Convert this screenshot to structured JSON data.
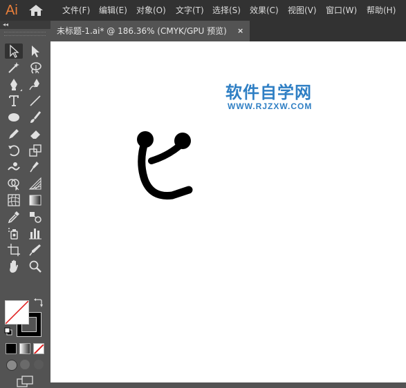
{
  "app": {
    "logo_text": "Ai",
    "home_icon": "home-icon"
  },
  "menu": [
    {
      "label": "文件(F)"
    },
    {
      "label": "编辑(E)"
    },
    {
      "label": "对象(O)"
    },
    {
      "label": "文字(T)"
    },
    {
      "label": "选择(S)"
    },
    {
      "label": "效果(C)"
    },
    {
      "label": "视图(V)"
    },
    {
      "label": "窗口(W)"
    },
    {
      "label": "帮助(H)"
    }
  ],
  "document_tab": {
    "label": "未标题-1.ai* @ 186.36% (CMYK/GPU 预览)",
    "close_label": "×"
  },
  "toolbar": {
    "collapse_label": "◂◂",
    "tools": [
      {
        "name": "selection-tool-icon",
        "active": true
      },
      {
        "name": "direct-selection-tool-icon"
      },
      {
        "name": "magic-wand-tool-icon"
      },
      {
        "name": "lasso-tool-icon"
      },
      {
        "name": "pen-tool-icon"
      },
      {
        "name": "curvature-tool-icon"
      },
      {
        "name": "type-tool-icon"
      },
      {
        "name": "line-segment-tool-icon"
      },
      {
        "name": "ellipse-tool-icon"
      },
      {
        "name": "paintbrush-tool-icon"
      },
      {
        "name": "pencil-tool-icon"
      },
      {
        "name": "eraser-tool-icon"
      },
      {
        "name": "rotate-tool-icon"
      },
      {
        "name": "scale-tool-icon"
      },
      {
        "name": "warp-tool-icon"
      },
      {
        "name": "puppet-warp-tool-icon"
      },
      {
        "name": "shape-builder-tool-icon"
      },
      {
        "name": "perspective-grid-tool-icon"
      },
      {
        "name": "mesh-tool-icon"
      },
      {
        "name": "gradient-tool-icon"
      },
      {
        "name": "eyedropper-tool-icon"
      },
      {
        "name": "blend-tool-icon"
      },
      {
        "name": "symbol-sprayer-tool-icon"
      },
      {
        "name": "column-graph-tool-icon"
      },
      {
        "name": "artboard-tool-icon"
      },
      {
        "name": "slice-tool-icon"
      },
      {
        "name": "hand-tool-icon"
      },
      {
        "name": "zoom-tool-icon"
      }
    ],
    "fill_color": "#ffffff",
    "stroke_color": "#000000"
  },
  "canvas": {
    "background": "#ffffff",
    "watermark_title": "软件自学网",
    "watermark_url": "WWW.RJZXW.COM",
    "watermark_color": "#2f7fc4"
  },
  "colors": {
    "menubar": "#323232",
    "panel": "#535353",
    "logo": "#e97f3a"
  }
}
